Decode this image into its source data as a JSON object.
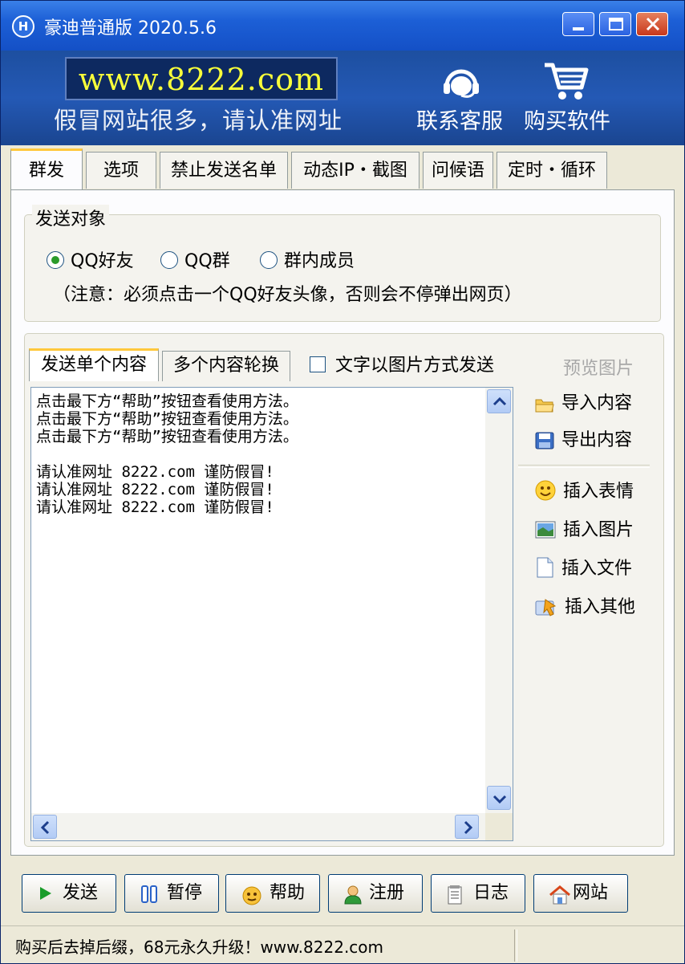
{
  "window": {
    "title": "豪迪普通版 2020.5.6",
    "icon_letter": "H"
  },
  "banner": {
    "url": "www.8222.com",
    "slogan": "假冒网站很多，请认准网址",
    "contact_label": "联系客服",
    "buy_label": "购买软件"
  },
  "tabs": [
    "群发",
    "选项",
    "禁止发送名单",
    "动态IP・截图",
    "问候语",
    "定时・循环"
  ],
  "send_target": {
    "title": "发送对象",
    "options": [
      "QQ好友",
      "QQ群",
      "群内成员"
    ],
    "selected": "QQ好友",
    "note": "（注意：必须点击一个QQ好友头像，否则会不停弹出网页）"
  },
  "content": {
    "tabs": [
      "发送单个内容",
      "多个内容轮换"
    ],
    "image_mode_label": "文字以图片方式发送",
    "preview_label": "预览图片",
    "lines": [
      "点击最下方“帮助”按钮查看使用方法。",
      "点击最下方“帮助”按钮查看使用方法。",
      "点击最下方“帮助”按钮查看使用方法。",
      "",
      "请认准网址 8222.com 谨防假冒!",
      "请认准网址 8222.com 谨防假冒!",
      "请认准网址 8222.com 谨防假冒!"
    ]
  },
  "side_actions": {
    "import": "导入内容",
    "export": "导出内容",
    "emoji": "插入表情",
    "image": "插入图片",
    "file": "插入文件",
    "other": "插入其他"
  },
  "buttons": {
    "send": "发送",
    "pause": "暂停",
    "help": "帮助",
    "register": "注册",
    "log": "日志",
    "website": "网站"
  },
  "status": "购买后去掉后缀，68元永久升级！www.8222.com",
  "colors": {
    "title_bar": "#1c5fd6",
    "banner": "#2459b5",
    "url_text": "#f8ff3a",
    "tab_highlight": "#ffc83c"
  }
}
